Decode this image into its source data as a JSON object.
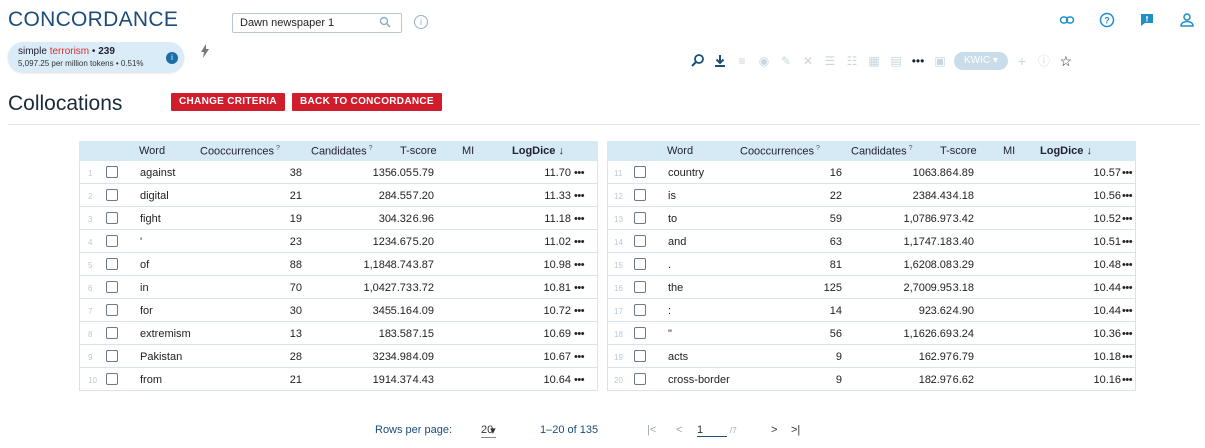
{
  "app": {
    "title": "CONCORDANCE",
    "corpus": "Dawn newspaper 1"
  },
  "query": {
    "prefix": "simple",
    "keyword": "terrorism",
    "count": "239",
    "stats": "5,097.25 per million tokens • 0.51%"
  },
  "toolbar": {
    "kwic_label": "KWIC"
  },
  "page": {
    "heading": "Collocations",
    "change_criteria": "CHANGE CRITERIA",
    "back_to_concordance": "BACK TO CONCORDANCE"
  },
  "columns": {
    "word": "Word",
    "cooccurrences": "Cooccurrences",
    "candidates": "Candidates",
    "tscore": "T-score",
    "mi": "MI",
    "logdice": "LogDice",
    "sort_arrow": "↓",
    "help_mark": "?"
  },
  "rows_left": [
    {
      "n": "1",
      "word": "against",
      "co": "38",
      "cand": "135",
      "t": "6.05",
      "mi": "5.79",
      "ld": "11.70"
    },
    {
      "n": "2",
      "word": "digital",
      "co": "21",
      "cand": "28",
      "t": "4.55",
      "mi": "7.20",
      "ld": "11.33"
    },
    {
      "n": "3",
      "word": "fight",
      "co": "19",
      "cand": "30",
      "t": "4.32",
      "mi": "6.96",
      "ld": "11.18"
    },
    {
      "n": "4",
      "word": "'",
      "co": "23",
      "cand": "123",
      "t": "4.67",
      "mi": "5.20",
      "ld": "11.02"
    },
    {
      "n": "5",
      "word": "of",
      "co": "88",
      "cand": "1,184",
      "t": "8.74",
      "mi": "3.87",
      "ld": "10.98"
    },
    {
      "n": "6",
      "word": "in",
      "co": "70",
      "cand": "1,042",
      "t": "7.73",
      "mi": "3.72",
      "ld": "10.81"
    },
    {
      "n": "7",
      "word": "for",
      "co": "30",
      "cand": "345",
      "t": "5.16",
      "mi": "4.09",
      "ld": "10.72"
    },
    {
      "n": "8",
      "word": "extremism",
      "co": "13",
      "cand": "18",
      "t": "3.58",
      "mi": "7.15",
      "ld": "10.69"
    },
    {
      "n": "9",
      "word": "Pakistan",
      "co": "28",
      "cand": "323",
      "t": "4.98",
      "mi": "4.09",
      "ld": "10.67"
    },
    {
      "n": "10",
      "word": "from",
      "co": "21",
      "cand": "191",
      "t": "4.37",
      "mi": "4.43",
      "ld": "10.64"
    }
  ],
  "rows_right": [
    {
      "n": "11",
      "word": "country",
      "co": "16",
      "cand": "106",
      "t": "3.86",
      "mi": "4.89",
      "ld": "10.57"
    },
    {
      "n": "12",
      "word": "is",
      "co": "22",
      "cand": "238",
      "t": "4.43",
      "mi": "4.18",
      "ld": "10.56"
    },
    {
      "n": "13",
      "word": "to",
      "co": "59",
      "cand": "1,078",
      "t": "6.97",
      "mi": "3.42",
      "ld": "10.52"
    },
    {
      "n": "14",
      "word": "and",
      "co": "63",
      "cand": "1,174",
      "t": "7.18",
      "mi": "3.40",
      "ld": "10.51"
    },
    {
      "n": "15",
      "word": ".",
      "co": "81",
      "cand": "1,620",
      "t": "8.08",
      "mi": "3.29",
      "ld": "10.48"
    },
    {
      "n": "16",
      "word": "the",
      "co": "125",
      "cand": "2,700",
      "t": "9.95",
      "mi": "3.18",
      "ld": "10.44"
    },
    {
      "n": "17",
      "word": ":",
      "co": "14",
      "cand": "92",
      "t": "3.62",
      "mi": "4.90",
      "ld": "10.44"
    },
    {
      "n": "18",
      "word": "\"",
      "co": "56",
      "cand": "1,162",
      "t": "6.69",
      "mi": "3.24",
      "ld": "10.36"
    },
    {
      "n": "19",
      "word": "acts",
      "co": "9",
      "cand": "16",
      "t": "2.97",
      "mi": "6.79",
      "ld": "10.18"
    },
    {
      "n": "20",
      "word": "cross-border",
      "co": "9",
      "cand": "18",
      "t": "2.97",
      "mi": "6.62",
      "ld": "10.16"
    }
  ],
  "pagination": {
    "rows_per_page_label": "Rows per page:",
    "rows_per_page": "20",
    "range": "1–20 of 135",
    "current_page": "1",
    "total_pages": "/7"
  },
  "icons": {
    "link": "link-icon",
    "help": "help-icon",
    "feedback": "feedback-icon",
    "user": "user-icon",
    "bolt": "bolt-icon",
    "search": "search-icon",
    "info": "info-icon",
    "star": "star-icon"
  }
}
